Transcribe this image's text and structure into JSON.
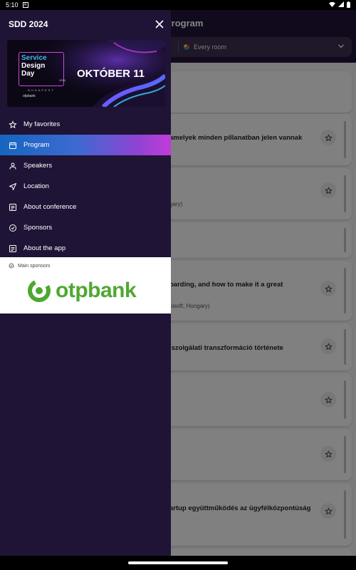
{
  "status_bar": {
    "time": "5:10",
    "notification_glyph": "A",
    "icons": [
      "wifi-icon",
      "signal-icon",
      "battery-icon"
    ]
  },
  "appbar": {
    "title": "Program"
  },
  "filter": {
    "room_label": "Every room"
  },
  "cards": [
    {
      "text": "",
      "sub": ""
    },
    {
      "text": "amelyek minden pillanatban jelen vannak",
      "sub": ""
    },
    {
      "text": "",
      "sub": "gary)"
    },
    {
      "text": "",
      "sub": ""
    },
    {
      "text": "oarding, and how to make it a great",
      "sub": "nisoft, Hungary)"
    },
    {
      "text": "lszolgálati transzformáció története",
      "sub": ""
    },
    {
      "text": "",
      "sub": ""
    },
    {
      "text": "",
      "sub": ""
    },
    {
      "text": "artup együttműködés az ügyfélközpontúság",
      "sub": ""
    },
    {
      "text": "",
      "sub": ""
    }
  ],
  "drawer": {
    "title": "SDD 2024",
    "banner": {
      "logo_line1": "Service",
      "logo_line2": "Design",
      "logo_line3": "Day",
      "year": "2024",
      "city": "BUDAPEST",
      "powered_by": "otpbank",
      "date": "OKTÓBER 11"
    },
    "nav": [
      {
        "label": "My favorites",
        "icon": "star-icon",
        "active": false
      },
      {
        "label": "Program",
        "icon": "calendar-icon",
        "active": true
      },
      {
        "label": "Speakers",
        "icon": "person-icon",
        "active": false
      },
      {
        "label": "Location",
        "icon": "navigation-icon",
        "active": false
      },
      {
        "label": "About conference",
        "icon": "article-icon",
        "active": false
      },
      {
        "label": "Sponsors",
        "icon": "verified-icon",
        "active": false
      },
      {
        "label": "About the app",
        "icon": "article-icon",
        "active": false
      }
    ],
    "sponsors_heading": "Main sponsors",
    "sponsor_name": "otpbank"
  },
  "colors": {
    "drawer_bg": "#1f1436",
    "accent_start": "#1565c0",
    "accent_end": "#c13cd8",
    "otp_green": "#4fa830"
  }
}
